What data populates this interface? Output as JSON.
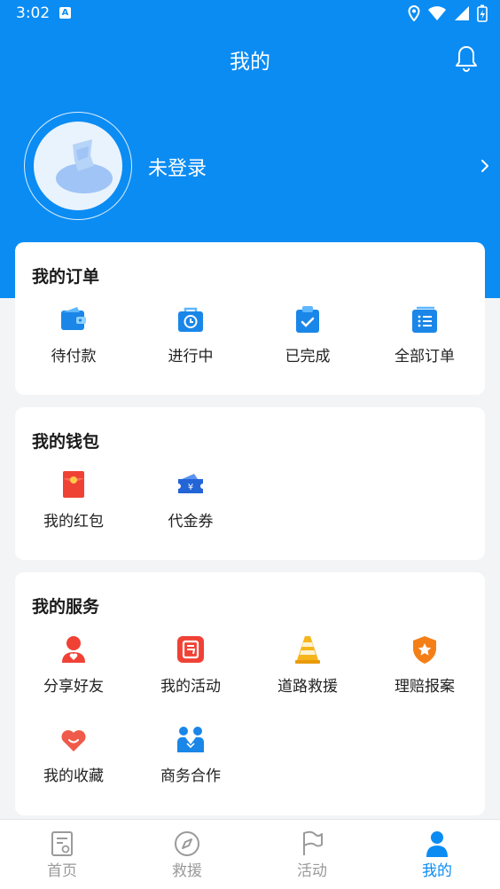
{
  "status_bar": {
    "time": "3:02",
    "indicator": "A"
  },
  "header": {
    "title": "我的"
  },
  "profile": {
    "login_text": "未登录"
  },
  "orders": {
    "title": "我的订单",
    "items": [
      {
        "label": "待付款",
        "icon": "wallet-icon"
      },
      {
        "label": "进行中",
        "icon": "clock-bag-icon"
      },
      {
        "label": "已完成",
        "icon": "check-clipboard-icon"
      },
      {
        "label": "全部订单",
        "icon": "list-icon"
      }
    ]
  },
  "wallet": {
    "title": "我的钱包",
    "items": [
      {
        "label": "我的红包",
        "icon": "red-packet-icon"
      },
      {
        "label": "代金券",
        "icon": "coupon-icon"
      }
    ]
  },
  "services": {
    "title": "我的服务",
    "items": [
      {
        "label": "分享好友",
        "icon": "share-user-icon"
      },
      {
        "label": "我的活动",
        "icon": "activity-icon"
      },
      {
        "label": "道路救援",
        "icon": "traffic-cone-icon"
      },
      {
        "label": "理赔报案",
        "icon": "shield-star-icon"
      },
      {
        "label": "我的收藏",
        "icon": "heart-icon"
      },
      {
        "label": "商务合作",
        "icon": "partners-icon"
      }
    ]
  },
  "bottom_nav": {
    "items": [
      {
        "label": "首页",
        "icon": "home-doc-icon"
      },
      {
        "label": "救援",
        "icon": "compass-icon"
      },
      {
        "label": "活动",
        "icon": "flag-icon"
      },
      {
        "label": "我的",
        "icon": "person-icon"
      }
    ],
    "active": "我的"
  },
  "colors": {
    "primary": "#0b8cf3",
    "background": "#f3f4f6",
    "inactive": "#9a9a9a"
  }
}
